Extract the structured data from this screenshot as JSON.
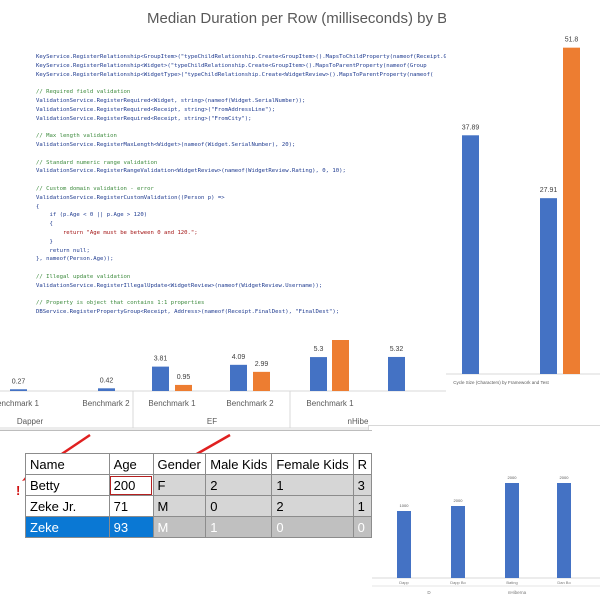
{
  "main_chart": {
    "title": "Median Duration per Row (milliseconds) by Benchmark",
    "groups": [
      "Dapper",
      "EF",
      "nHibe"
    ],
    "category_labels": [
      "enchmark 1",
      "Benchmark 2",
      "Benchmark 1",
      "Benchmark 2",
      "Benchmark 1"
    ],
    "colors": {
      "blue": "#4472c4",
      "orange": "#ed7d31"
    }
  },
  "chart_data": [
    {
      "type": "bar",
      "title": "Median Duration per Row (milliseconds) by Benchmark",
      "series": [
        {
          "values": [
            0.27,
            0.42,
            3.81,
            4.09,
            5.3,
            5.32
          ]
        },
        {
          "values": [
            null,
            null,
            0.95,
            2.99,
            null,
            null
          ]
        }
      ],
      "data_labels": [
        "0.27",
        "0.42",
        "3.81",
        "0.95",
        "4.09",
        "2.99",
        "5.3",
        "5.32"
      ]
    },
    {
      "type": "bar",
      "series": [
        {
          "values": [
            37.89,
            27.91
          ]
        },
        {
          "values": [
            51.8
          ]
        }
      ],
      "data_labels": [
        "37.89",
        "27.91",
        "51.8"
      ],
      "xlabel": "Cycle Size (Characters) by Framework and Test"
    }
  ],
  "code": [
    {
      "cls": "k",
      "text": "KeyService.RegisterRelationship<GroupItem>(\"typeChildRelationship.Create<GroupItem>().MapsToChildProperty(nameof(Receipt.Gro"
    },
    {
      "cls": "k",
      "text": "KeyService.RegisterRelationship<Widget>(\"typeChildRelationship.Create<GroupItem>().MapsToParentProperty(nameof(Group"
    },
    {
      "cls": "k",
      "text": "KeyService.RegisterRelationship<WidgetType>(\"typeChildRelationship.Create<WidgetReview>().MapsToParentProperty(nameof("
    },
    {
      "cls": "",
      "text": ""
    },
    {
      "cls": "c",
      "text": "// Required field validation"
    },
    {
      "cls": "k",
      "text": "ValidationService.RegisterRequired<Widget, string>(nameof(Widget.SerialNumber));"
    },
    {
      "cls": "k",
      "text": "ValidationService.RegisterRequired<Receipt, string>(\"FromAddressLine\");"
    },
    {
      "cls": "k",
      "text": "ValidationService.RegisterRequired<Receipt, string>(\"FromCity\");"
    },
    {
      "cls": "",
      "text": ""
    },
    {
      "cls": "c",
      "text": "// Max length validation"
    },
    {
      "cls": "k",
      "text": "ValidationService.RegisterMaxLength<Widget>(nameof(Widget.SerialNumber), 20);"
    },
    {
      "cls": "",
      "text": ""
    },
    {
      "cls": "c",
      "text": "// Standard numeric range validation"
    },
    {
      "cls": "k",
      "text": "ValidationService.RegisterRangeValidation<WidgetReview>(nameof(WidgetReview.Rating), 0, 10);"
    },
    {
      "cls": "",
      "text": ""
    },
    {
      "cls": "c",
      "text": "// Custom domain validation - error"
    },
    {
      "cls": "k",
      "text": "ValidationService.RegisterCustomValidation((Person p) =>"
    },
    {
      "cls": "k",
      "text": "{"
    },
    {
      "cls": "k",
      "text": "    if (p.Age < 0 || p.Age > 120)"
    },
    {
      "cls": "k",
      "text": "    {"
    },
    {
      "cls": "s",
      "text": "        return \"Age must be between 0 and 120.\";"
    },
    {
      "cls": "k",
      "text": "    }"
    },
    {
      "cls": "k",
      "text": "    return null;"
    },
    {
      "cls": "k",
      "text": "}, nameof(Person.Age));"
    },
    {
      "cls": "",
      "text": ""
    },
    {
      "cls": "c",
      "text": "// Illegal update validation"
    },
    {
      "cls": "k",
      "text": "ValidationService.RegisterIllegalUpdate<WidgetReview>(nameof(WidgetReview.Username));"
    },
    {
      "cls": "",
      "text": ""
    },
    {
      "cls": "c",
      "text": "// Property is object that contains 1:1 properties"
    },
    {
      "cls": "k",
      "text": "DBService.RegisterPropertyGroup<Receipt, Address>(nameof(Receipt.FinalDest), \"FinalDest\");"
    }
  ],
  "grid": {
    "headers": [
      "Name",
      "Age",
      "Gender",
      "Male Kids",
      "Female Kids",
      "R"
    ],
    "rows": [
      {
        "cells": [
          "Betty",
          "200",
          "F",
          "2",
          "1",
          "3"
        ],
        "state": "error"
      },
      {
        "cells": [
          "Zeke Jr.",
          "71",
          "M",
          "0",
          "2",
          "1"
        ],
        "state": "normal"
      },
      {
        "cells": [
          "Zeke",
          "93",
          "M",
          "1",
          "0",
          "0"
        ],
        "state": "selected"
      }
    ],
    "error_mark": "!"
  },
  "small_chart": {
    "labels": [
      "1000",
      "2000",
      "2000",
      "2000"
    ],
    "categories": [
      "Dapp",
      "Dapp Bo",
      "Bating",
      "Dan Bo"
    ],
    "axis_labels": [
      "D",
      "nHiberna"
    ]
  }
}
